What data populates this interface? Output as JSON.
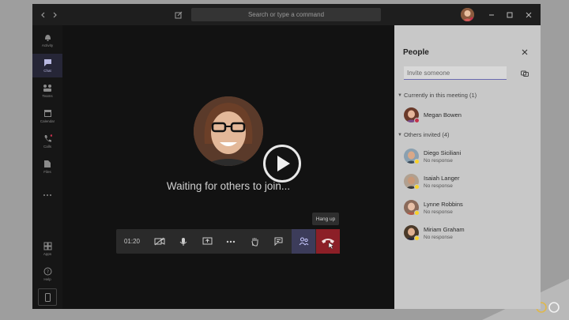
{
  "titlebar": {
    "search_placeholder": "Search or type a command"
  },
  "rail": {
    "items": [
      {
        "label": "Activity",
        "icon": "bell-icon"
      },
      {
        "label": "Chat",
        "icon": "chat-icon",
        "active": true
      },
      {
        "label": "Teams",
        "icon": "teams-icon"
      },
      {
        "label": "Calendar",
        "icon": "calendar-icon"
      },
      {
        "label": "Calls",
        "icon": "phone-icon"
      },
      {
        "label": "Files",
        "icon": "files-icon"
      },
      {
        "label": "Apps",
        "icon": "apps-icon"
      },
      {
        "label": "Help",
        "icon": "help-icon"
      }
    ]
  },
  "stage": {
    "waiting_text": "Waiting for others to join...",
    "timer": "01:20",
    "tooltip": "Hang up"
  },
  "people_panel": {
    "title": "People",
    "invite_placeholder": "Invite someone",
    "in_meeting_header": "Currently in this meeting (1)",
    "others_header": "Others invited (4)",
    "in_meeting": [
      {
        "name": "Megan Bowen",
        "status_color": "#c4314b"
      }
    ],
    "invited": [
      {
        "name": "Diego Siciliani",
        "status": "No response",
        "status_color": "#f8d22a"
      },
      {
        "name": "Isaiah Langer",
        "status": "No response",
        "status_color": "#f8d22a"
      },
      {
        "name": "Lynne Robbins",
        "status": "No response",
        "status_color": "#f8d22a"
      },
      {
        "name": "Miriam Graham",
        "status": "No response",
        "status_color": "#f8d22a"
      }
    ]
  },
  "colors": {
    "accent": "#6264a7",
    "hangup": "#c4314b"
  }
}
